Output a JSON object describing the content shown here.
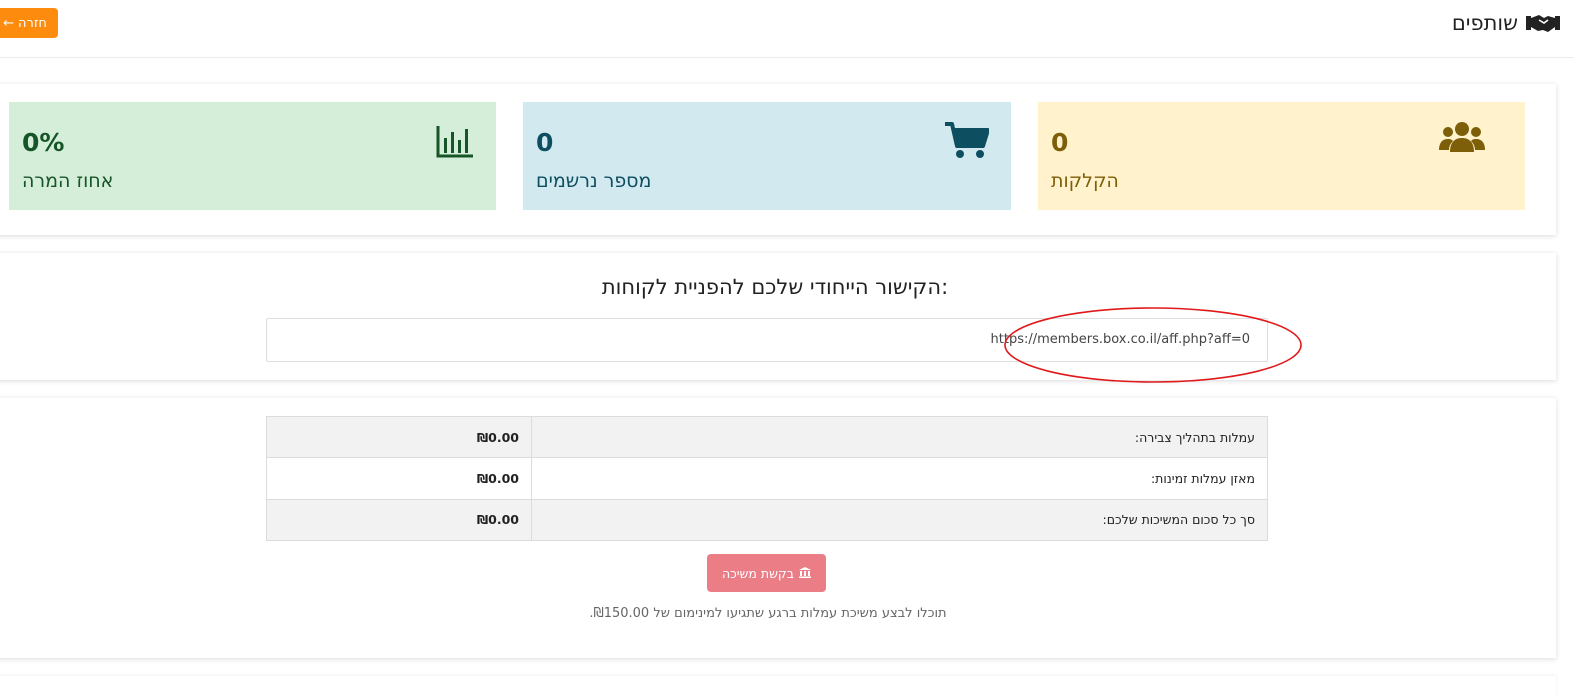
{
  "header": {
    "title": "שותפים",
    "title_icon": "handshake-icon",
    "back_label": "חזרה",
    "back_icon": "arrow-left-icon",
    "back_color": "#fd8c0e"
  },
  "stats": {
    "clicks": {
      "value": "0",
      "label": "הקלקות",
      "icon": "users-icon",
      "bg": "#fff2cc"
    },
    "signups": {
      "value": "0",
      "label": "מספר נרשמים",
      "icon": "shopping-cart-icon",
      "bg": "#d1e9ef"
    },
    "conversion": {
      "value": "0%",
      "label": "אחוז המרה",
      "icon": "bar-chart-icon",
      "bg": "#d5eeda"
    }
  },
  "referral": {
    "title": "הקישור הייחודי שלכם להפניית לקוחות:",
    "url": "https://members.box.co.il/aff.php?aff=0",
    "highlight_color": "#e0191b"
  },
  "balances": {
    "rows": [
      {
        "label": "עמלות בתהליך צבירה:",
        "value": "₪0.00"
      },
      {
        "label": "מאזן עמלות זמינות:",
        "value": "₪0.00"
      },
      {
        "label": "סך כל סכום המשיכות שלכם:",
        "value": "₪0.00"
      }
    ],
    "withdraw_label": "בקשת משיכה",
    "withdraw_icon": "bank-icon",
    "withdraw_color": "#eb7d87",
    "note": "תוכלו לבצע משיכת עמלות ברגע שתגיעו למינימום של ₪150.00."
  }
}
